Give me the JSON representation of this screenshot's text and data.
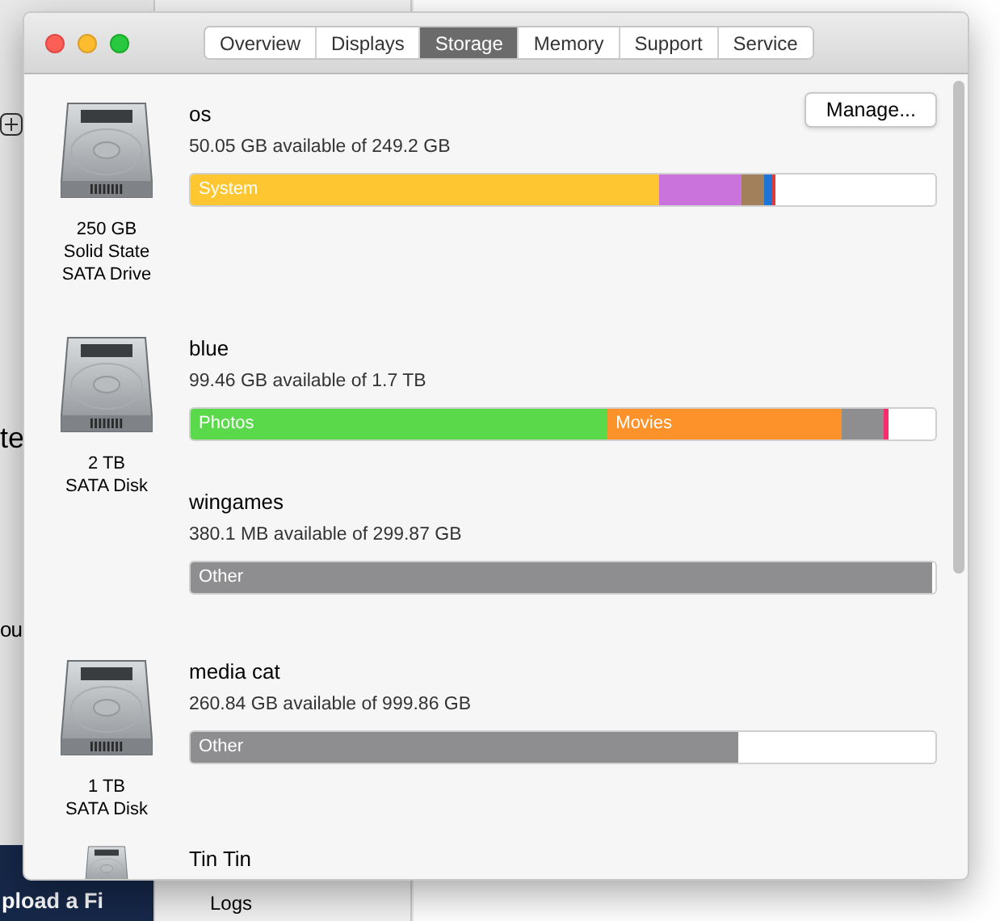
{
  "background": {
    "left_texts": [
      "te",
      "ou"
    ],
    "banner": "pload a Fi",
    "side_item": "Logs"
  },
  "window": {
    "tabs": [
      {
        "label": "Overview",
        "selected": false
      },
      {
        "label": "Displays",
        "selected": false
      },
      {
        "label": "Storage",
        "selected": true
      },
      {
        "label": "Memory",
        "selected": false
      },
      {
        "label": "Support",
        "selected": false
      },
      {
        "label": "Service",
        "selected": false
      }
    ]
  },
  "disks": [
    {
      "caption": [
        "250 GB",
        "Solid State",
        "SATA Drive"
      ],
      "volumes": [
        {
          "name": "os",
          "available": "50.05 GB available of 249.2 GB",
          "button": "Manage...",
          "segments": [
            {
              "label": "System",
              "color": "#fec631"
            },
            {
              "color": "#cb73dd"
            },
            {
              "color": "#a2805c"
            },
            {
              "color": "#1b74d6"
            },
            {
              "color": "#e03a3a"
            }
          ]
        }
      ]
    },
    {
      "caption": [
        "2 TB",
        "SATA Disk"
      ],
      "volumes": [
        {
          "name": "blue",
          "available": "99.46 GB available of 1.7 TB",
          "segments": [
            {
              "label": "Photos",
              "color": "#5ad94b"
            },
            {
              "label": "Movies",
              "color": "#fe922a"
            },
            {
              "color": "#8e8e90"
            },
            {
              "color": "#fb2c6d"
            }
          ]
        },
        {
          "name": "wingames",
          "available": "380.1 MB available of 299.87 GB",
          "segments": [
            {
              "label": "Other",
              "color": "#8e8e90"
            }
          ]
        }
      ]
    },
    {
      "caption": [
        "1 TB",
        "SATA Disk"
      ],
      "volumes": [
        {
          "name": "media cat",
          "available": "260.84 GB available of 999.86 GB",
          "segments": [
            {
              "label": "Other",
              "color": "#8e8e90"
            }
          ]
        }
      ]
    },
    {
      "volumes": [
        {
          "name": "Tin Tin"
        }
      ]
    }
  ]
}
